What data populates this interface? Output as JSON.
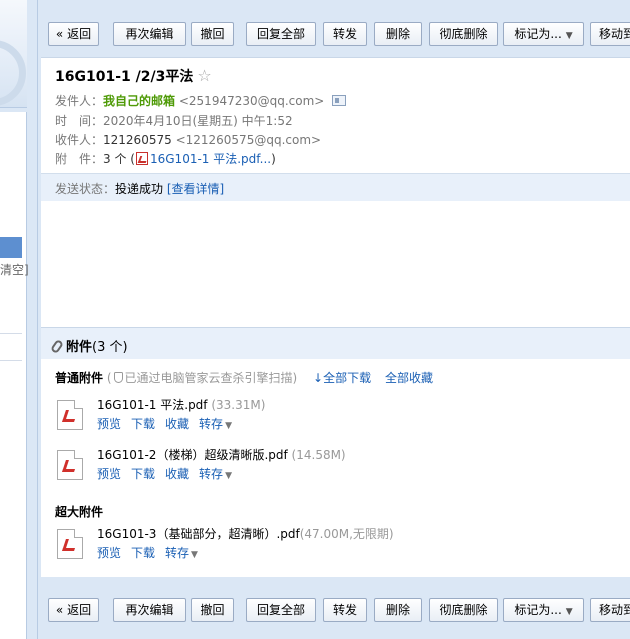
{
  "sidebar": {
    "fragment_text": "清空]"
  },
  "toolbar": {
    "back": "« 返回",
    "edit_again": "再次编辑",
    "recall": "撤回",
    "reply_all": "回复全部",
    "forward": "转发",
    "delete": "删除",
    "delete_permanent": "彻底删除",
    "mark_as": "标记为...",
    "move_to": "移动到"
  },
  "mail": {
    "subject": "16G101-1 /2/3平法",
    "star": "☆",
    "from_label": "发件人：",
    "from_name": "我自己的邮箱",
    "from_email": "<251947230@qq.com>",
    "time_label": "时　间：",
    "time_value": "2020年4月10日(星期五) 中午1:52",
    "to_label": "收件人：",
    "to_name": "121260575",
    "to_email": "<121260575@qq.com>",
    "att_label": "附　件：",
    "att_count": "3 个",
    "att_open": "(",
    "att_link": "16G101-1 平法.pdf...",
    "att_close": ")",
    "status_label": "发送状态：",
    "status_value": "投递成功",
    "status_link": "[查看详情]"
  },
  "attachments": {
    "header_title": "附件",
    "header_count": "(3 个)",
    "normal_title": "普通附件",
    "scan_open": "(",
    "scan_text": "已通过电脑管家云查杀引擎扫描)",
    "download_all": "全部下载",
    "save_all": "全部收藏",
    "large_title": "超大附件",
    "actions": {
      "preview": "预览",
      "download": "下载",
      "favorite": "收藏",
      "save_to": "转存"
    },
    "files": [
      {
        "name": "16G101-1 平法.pdf",
        "size": "(33.31M)"
      },
      {
        "name": "16G101-2（楼梯）超级清晰版.pdf",
        "size": "(14.58M)"
      }
    ],
    "large_files": [
      {
        "name": "16G101-3（基础部分，超清晰）.pdf",
        "size": "(47.00M,无限期)"
      }
    ]
  }
}
